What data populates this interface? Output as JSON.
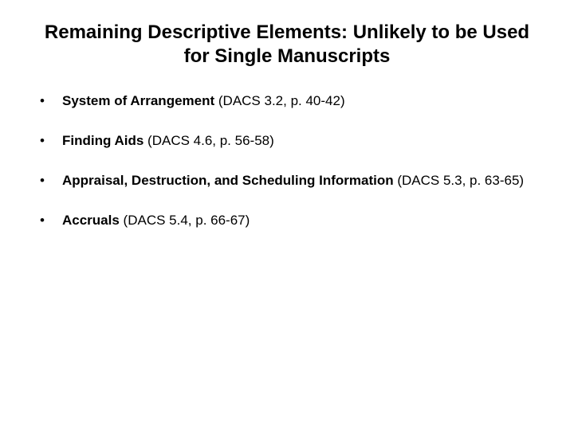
{
  "title": "Remaining Descriptive Elements: Unlikely to be Used for Single Manuscripts",
  "items": [
    {
      "lead": "System of Arrangement",
      "rest": " (DACS 3.2, p. 40-42)"
    },
    {
      "lead": "Finding Aids",
      "rest": " (DACS 4.6, p. 56-58)"
    },
    {
      "lead": "Appraisal, Destruction, and Scheduling Information",
      "rest": " (DACS 5.3, p. 63-65)"
    },
    {
      "lead": "Accruals",
      "rest": " (DACS 5.4, p. 66-67)"
    }
  ]
}
